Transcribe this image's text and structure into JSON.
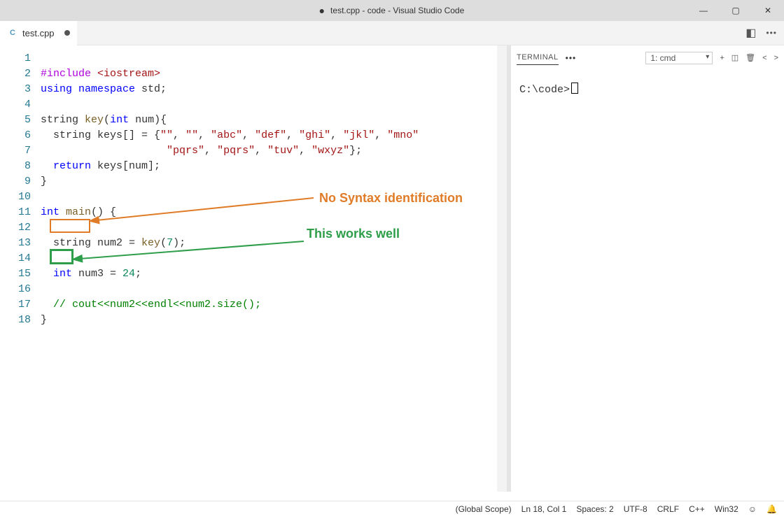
{
  "titlebar": {
    "title": "test.cpp - code - Visual Studio Code"
  },
  "tab": {
    "file": "test.cpp"
  },
  "gutter": [
    "1",
    "2",
    "3",
    "4",
    "5",
    "6",
    "7",
    "8",
    "9",
    "10",
    "11",
    "12",
    "13",
    "14",
    "15",
    "16",
    "17",
    "18"
  ],
  "code": {
    "l1_pp": "#include ",
    "l1_inc": "<iostream>",
    "l2_kw1": "using ",
    "l2_kw2": "namespace ",
    "l2_ns": "std",
    "l2_end": ";",
    "l4_t": "string",
    "l4_sp": " ",
    "l4_fn": "key",
    "l4_open": "(",
    "l4_pkw": "int",
    "l4_pn": " num",
    "l4_close": "){",
    "l5_indent": "  string keys[] = {",
    "l5_s": "\"\"",
    "l5_c": ", ",
    "l5_s2": "\"\"",
    "l5_s3": "\"abc\"",
    "l5_s4": "\"def\"",
    "l5_s5": "\"ghi\"",
    "l5_s6": "\"jkl\"",
    "l5_s7": "\"mno\"",
    "l6_indent": "                    ",
    "l6_s1": "\"pqrs\"",
    "l6_s2": "\"pqrs\"",
    "l6_s3": "\"tuv\"",
    "l6_s4": "\"wxyz\"",
    "l6_end": "};",
    "l7": "  ",
    "l7_kw": "return",
    "l7_rest": " keys[num];",
    "l8": "}",
    "l10_kw": "int",
    "l10_sp": " ",
    "l10_fn": "main",
    "l10_rest": "() {",
    "l12_indent": "  ",
    "l12_t": "string",
    "l12_rest": " num2 = ",
    "l12_fn": "key",
    "l12_open": "(",
    "l12_n": "7",
    "l12_close": ");",
    "l14_indent": "  ",
    "l14_kw": "int",
    "l14_rest": " num3 = ",
    "l14_n": "24",
    "l14_end": ";",
    "l16_indent": "  ",
    "l16_cm": "// cout<<num2<<endl<<num2.size();",
    "l17": "}"
  },
  "annotations": {
    "orange": "No Syntax identification",
    "green": "This works well"
  },
  "panel": {
    "tab": "TERMINAL",
    "select": "1: cmd",
    "prompt": "C:\\code>"
  },
  "status": {
    "scope": "(Global Scope)",
    "pos": "Ln 18, Col 1",
    "spaces": "Spaces: 2",
    "enc": "UTF-8",
    "eol": "CRLF",
    "lang": "C++",
    "target": "Win32"
  }
}
